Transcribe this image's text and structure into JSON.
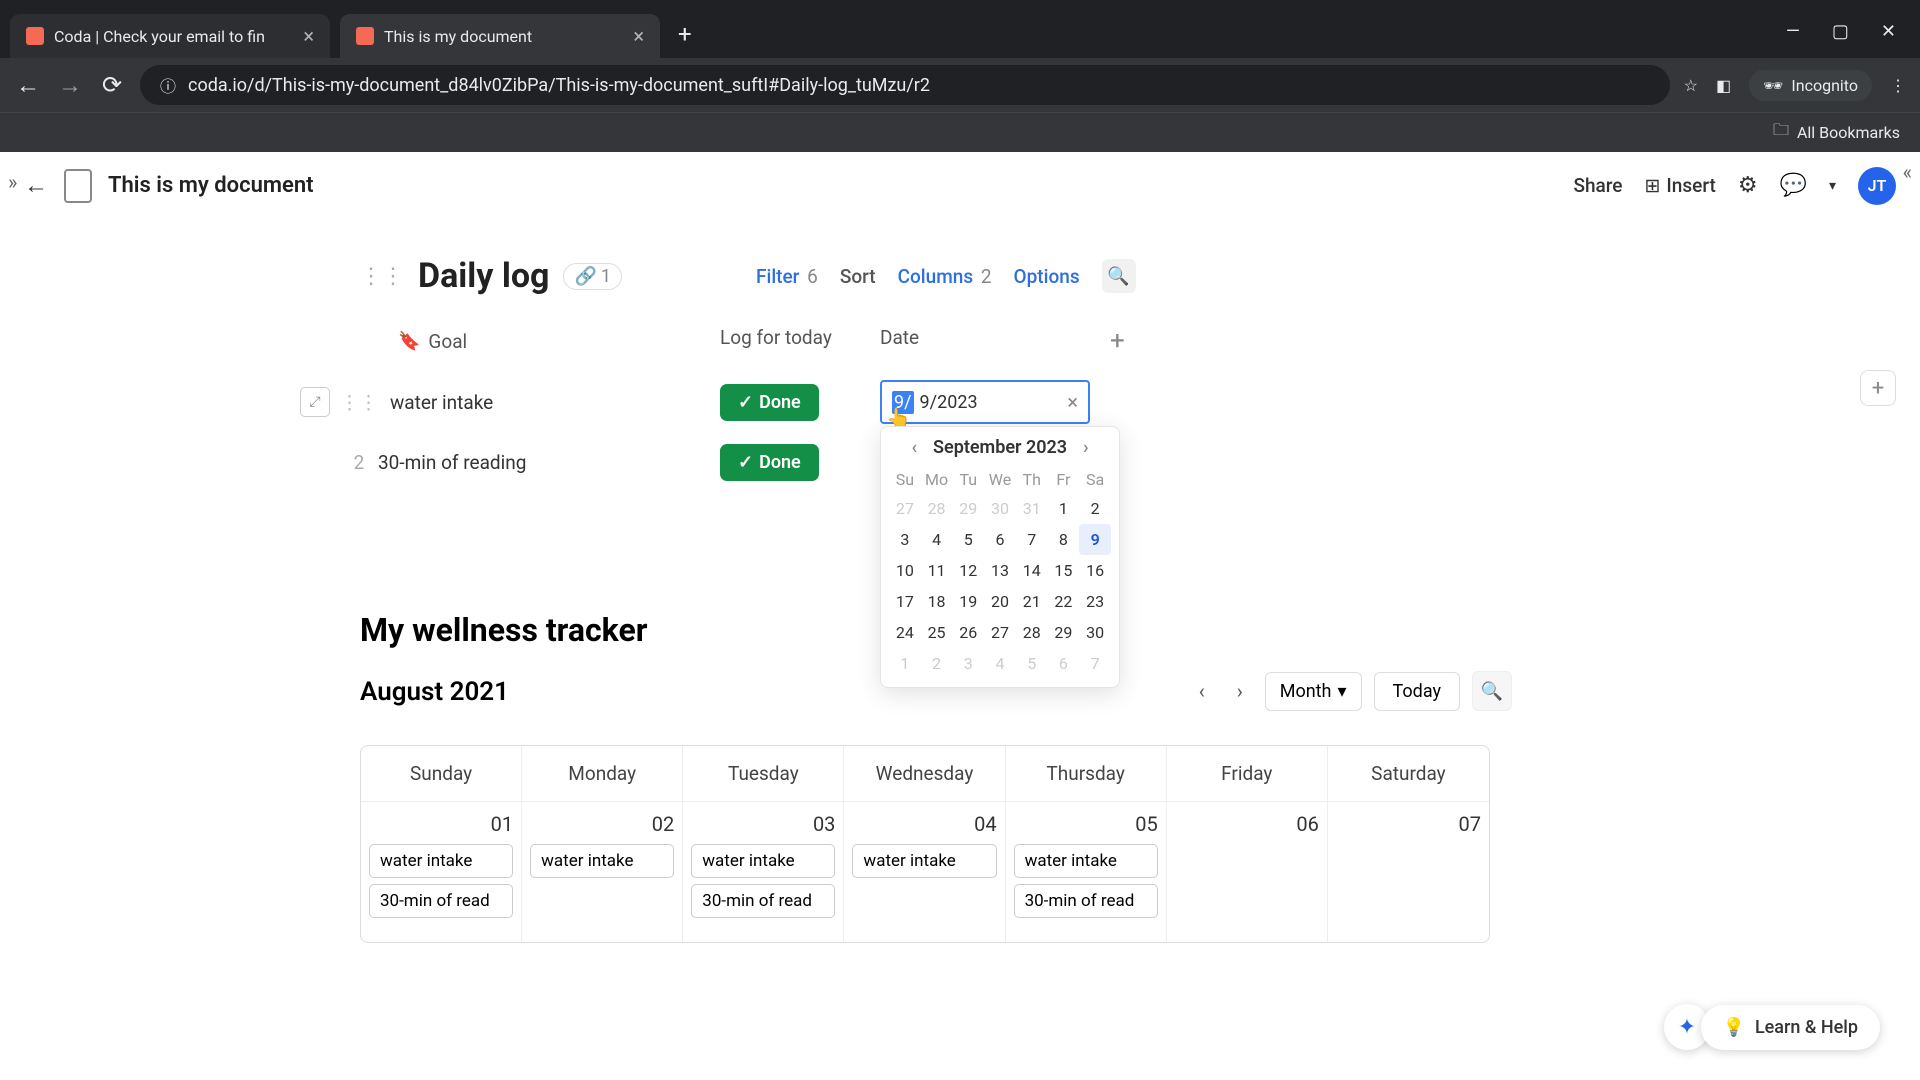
{
  "browser": {
    "tabs": [
      {
        "title": "Coda | Check your email to fin"
      },
      {
        "title": "This is my document"
      }
    ],
    "url": "coda.io/d/This-is-my-document_d84lv0ZibPa/This-is-my-document_suftI#Daily-log_tuMzu/r2",
    "incognito_label": "Incognito",
    "all_bookmarks": "All Bookmarks"
  },
  "app_header": {
    "doc_title": "This is my document",
    "share": "Share",
    "insert": "Insert",
    "avatar": "JT"
  },
  "daily_log": {
    "title": "Daily log",
    "link_count": "1",
    "controls": {
      "filter_label": "Filter",
      "filter_count": "6",
      "sort_label": "Sort",
      "columns_label": "Columns",
      "columns_count": "2",
      "options_label": "Options"
    },
    "columns": {
      "goal": "Goal",
      "log": "Log for today",
      "date": "Date"
    },
    "rows": [
      {
        "num": "",
        "goal": "water intake",
        "done": "Done",
        "date_display": "9/2023",
        "date_prefix_selected": "9/"
      },
      {
        "num": "2",
        "goal": "30-min of reading",
        "done": "Done"
      }
    ]
  },
  "date_picker": {
    "month_label": "September 2023",
    "dow": [
      "Su",
      "Mo",
      "Tu",
      "We",
      "Th",
      "Fr",
      "Sa"
    ],
    "weeks": [
      [
        {
          "d": "27",
          "m": true
        },
        {
          "d": "28",
          "m": true
        },
        {
          "d": "29",
          "m": true
        },
        {
          "d": "30",
          "m": true
        },
        {
          "d": "31",
          "m": true
        },
        {
          "d": "1"
        },
        {
          "d": "2"
        }
      ],
      [
        {
          "d": "3"
        },
        {
          "d": "4"
        },
        {
          "d": "5"
        },
        {
          "d": "6"
        },
        {
          "d": "7"
        },
        {
          "d": "8"
        },
        {
          "d": "9",
          "t": true
        }
      ],
      [
        {
          "d": "10"
        },
        {
          "d": "11"
        },
        {
          "d": "12"
        },
        {
          "d": "13"
        },
        {
          "d": "14"
        },
        {
          "d": "15"
        },
        {
          "d": "16"
        }
      ],
      [
        {
          "d": "17"
        },
        {
          "d": "18"
        },
        {
          "d": "19"
        },
        {
          "d": "20"
        },
        {
          "d": "21"
        },
        {
          "d": "22"
        },
        {
          "d": "23"
        }
      ],
      [
        {
          "d": "24"
        },
        {
          "d": "25"
        },
        {
          "d": "26"
        },
        {
          "d": "27"
        },
        {
          "d": "28"
        },
        {
          "d": "29"
        },
        {
          "d": "30"
        }
      ],
      [
        {
          "d": "1",
          "m": true
        },
        {
          "d": "2",
          "m": true
        },
        {
          "d": "3",
          "m": true
        },
        {
          "d": "4",
          "m": true
        },
        {
          "d": "5",
          "m": true
        },
        {
          "d": "6",
          "m": true
        },
        {
          "d": "7",
          "m": true
        }
      ]
    ]
  },
  "wellness": {
    "title": "My wellness tracker",
    "month": "August 2021",
    "view_label": "Month",
    "today_label": "Today",
    "dow": [
      "Sunday",
      "Monday",
      "Tuesday",
      "Wednesday",
      "Thursday",
      "Friday",
      "Saturday"
    ],
    "cells": [
      {
        "date": "01",
        "events": [
          "water intake",
          "30-min of read"
        ]
      },
      {
        "date": "02",
        "events": [
          "water intake"
        ]
      },
      {
        "date": "03",
        "events": [
          "water intake",
          "30-min of read"
        ]
      },
      {
        "date": "04",
        "events": [
          "water intake"
        ]
      },
      {
        "date": "05",
        "events": [
          "water intake",
          "30-min of read"
        ]
      },
      {
        "date": "06",
        "events": []
      },
      {
        "date": "07",
        "events": []
      }
    ]
  },
  "help": {
    "label": "Learn & Help"
  }
}
